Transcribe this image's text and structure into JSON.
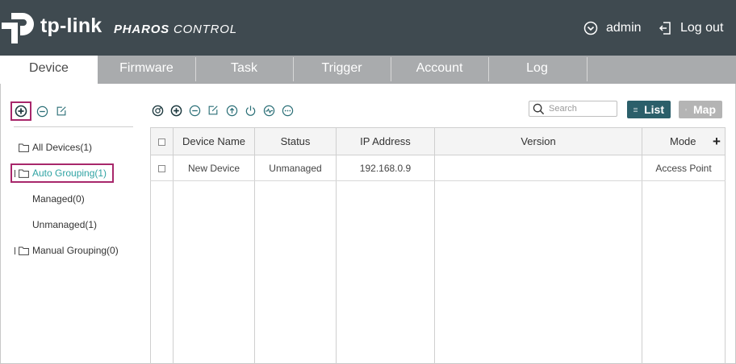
{
  "header": {
    "logo_text": "tp-link",
    "product_name_bold": "PHAROS",
    "product_name_rest": " CONTROL",
    "user_label": "admin",
    "logout_label": "Log out"
  },
  "tabs": [
    {
      "label": "Device",
      "active": true
    },
    {
      "label": "Firmware",
      "active": false
    },
    {
      "label": "Task",
      "active": false
    },
    {
      "label": "Trigger",
      "active": false
    },
    {
      "label": "Account",
      "active": false
    },
    {
      "label": "Log",
      "active": false
    }
  ],
  "tree": {
    "toolbar_icons": [
      "add-group-icon",
      "remove-group-icon",
      "edit-group-icon"
    ],
    "items": [
      {
        "label": "All Devices(1)",
        "icon": "folder-icon"
      },
      {
        "label": "Auto Grouping(1)",
        "icon": "folder-icon",
        "selected": true
      },
      {
        "label": "Managed(0)"
      },
      {
        "label": "Unmanaged(1)"
      },
      {
        "label": "Manual Grouping(0)",
        "icon": "folder-icon"
      }
    ]
  },
  "toolbar": {
    "icons": [
      "adopt-icon",
      "add-icon",
      "remove-icon",
      "edit-icon",
      "upgrade-icon",
      "power-icon",
      "monitor-icon",
      "more-icon"
    ],
    "search_placeholder": "Search",
    "list_label": "List",
    "map_label": "Map"
  },
  "table": {
    "columns": [
      "Device Name",
      "Status",
      "IP Address",
      "Version",
      "Mode"
    ],
    "rows": [
      {
        "device_name": "New Device",
        "status": "Unmanaged",
        "ip_address": "192.168.0.9",
        "version": "",
        "mode": "Access Point"
      }
    ]
  },
  "colors": {
    "header_bg": "#3f4a50",
    "tab_bar": "#a9abad",
    "highlight": "#a8276b",
    "selected_text": "#2fa3a3",
    "list_button": "#2b5f6a"
  }
}
